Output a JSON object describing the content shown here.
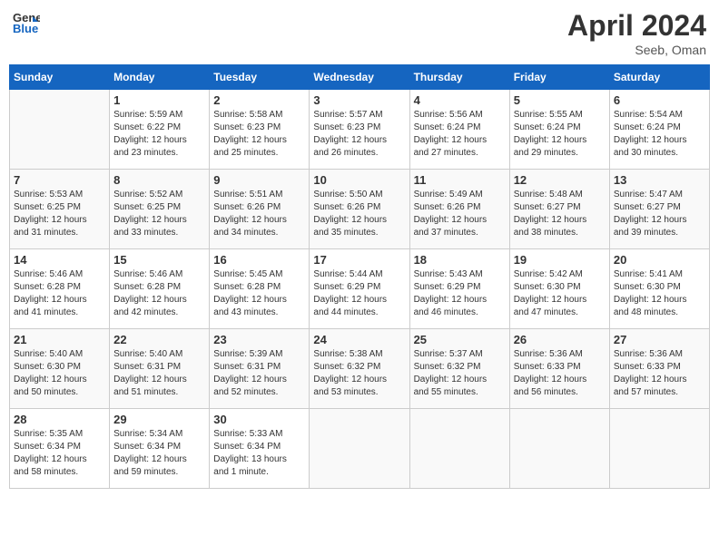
{
  "header": {
    "logo_line1": "General",
    "logo_line2": "Blue",
    "month": "April 2024",
    "location": "Seeb, Oman"
  },
  "weekdays": [
    "Sunday",
    "Monday",
    "Tuesday",
    "Wednesday",
    "Thursday",
    "Friday",
    "Saturday"
  ],
  "weeks": [
    [
      {
        "day": "",
        "info": ""
      },
      {
        "day": "1",
        "info": "Sunrise: 5:59 AM\nSunset: 6:22 PM\nDaylight: 12 hours\nand 23 minutes."
      },
      {
        "day": "2",
        "info": "Sunrise: 5:58 AM\nSunset: 6:23 PM\nDaylight: 12 hours\nand 25 minutes."
      },
      {
        "day": "3",
        "info": "Sunrise: 5:57 AM\nSunset: 6:23 PM\nDaylight: 12 hours\nand 26 minutes."
      },
      {
        "day": "4",
        "info": "Sunrise: 5:56 AM\nSunset: 6:24 PM\nDaylight: 12 hours\nand 27 minutes."
      },
      {
        "day": "5",
        "info": "Sunrise: 5:55 AM\nSunset: 6:24 PM\nDaylight: 12 hours\nand 29 minutes."
      },
      {
        "day": "6",
        "info": "Sunrise: 5:54 AM\nSunset: 6:24 PM\nDaylight: 12 hours\nand 30 minutes."
      }
    ],
    [
      {
        "day": "7",
        "info": "Sunrise: 5:53 AM\nSunset: 6:25 PM\nDaylight: 12 hours\nand 31 minutes."
      },
      {
        "day": "8",
        "info": "Sunrise: 5:52 AM\nSunset: 6:25 PM\nDaylight: 12 hours\nand 33 minutes."
      },
      {
        "day": "9",
        "info": "Sunrise: 5:51 AM\nSunset: 6:26 PM\nDaylight: 12 hours\nand 34 minutes."
      },
      {
        "day": "10",
        "info": "Sunrise: 5:50 AM\nSunset: 6:26 PM\nDaylight: 12 hours\nand 35 minutes."
      },
      {
        "day": "11",
        "info": "Sunrise: 5:49 AM\nSunset: 6:26 PM\nDaylight: 12 hours\nand 37 minutes."
      },
      {
        "day": "12",
        "info": "Sunrise: 5:48 AM\nSunset: 6:27 PM\nDaylight: 12 hours\nand 38 minutes."
      },
      {
        "day": "13",
        "info": "Sunrise: 5:47 AM\nSunset: 6:27 PM\nDaylight: 12 hours\nand 39 minutes."
      }
    ],
    [
      {
        "day": "14",
        "info": "Sunrise: 5:46 AM\nSunset: 6:28 PM\nDaylight: 12 hours\nand 41 minutes."
      },
      {
        "day": "15",
        "info": "Sunrise: 5:46 AM\nSunset: 6:28 PM\nDaylight: 12 hours\nand 42 minutes."
      },
      {
        "day": "16",
        "info": "Sunrise: 5:45 AM\nSunset: 6:28 PM\nDaylight: 12 hours\nand 43 minutes."
      },
      {
        "day": "17",
        "info": "Sunrise: 5:44 AM\nSunset: 6:29 PM\nDaylight: 12 hours\nand 44 minutes."
      },
      {
        "day": "18",
        "info": "Sunrise: 5:43 AM\nSunset: 6:29 PM\nDaylight: 12 hours\nand 46 minutes."
      },
      {
        "day": "19",
        "info": "Sunrise: 5:42 AM\nSunset: 6:30 PM\nDaylight: 12 hours\nand 47 minutes."
      },
      {
        "day": "20",
        "info": "Sunrise: 5:41 AM\nSunset: 6:30 PM\nDaylight: 12 hours\nand 48 minutes."
      }
    ],
    [
      {
        "day": "21",
        "info": "Sunrise: 5:40 AM\nSunset: 6:30 PM\nDaylight: 12 hours\nand 50 minutes."
      },
      {
        "day": "22",
        "info": "Sunrise: 5:40 AM\nSunset: 6:31 PM\nDaylight: 12 hours\nand 51 minutes."
      },
      {
        "day": "23",
        "info": "Sunrise: 5:39 AM\nSunset: 6:31 PM\nDaylight: 12 hours\nand 52 minutes."
      },
      {
        "day": "24",
        "info": "Sunrise: 5:38 AM\nSunset: 6:32 PM\nDaylight: 12 hours\nand 53 minutes."
      },
      {
        "day": "25",
        "info": "Sunrise: 5:37 AM\nSunset: 6:32 PM\nDaylight: 12 hours\nand 55 minutes."
      },
      {
        "day": "26",
        "info": "Sunrise: 5:36 AM\nSunset: 6:33 PM\nDaylight: 12 hours\nand 56 minutes."
      },
      {
        "day": "27",
        "info": "Sunrise: 5:36 AM\nSunset: 6:33 PM\nDaylight: 12 hours\nand 57 minutes."
      }
    ],
    [
      {
        "day": "28",
        "info": "Sunrise: 5:35 AM\nSunset: 6:34 PM\nDaylight: 12 hours\nand 58 minutes."
      },
      {
        "day": "29",
        "info": "Sunrise: 5:34 AM\nSunset: 6:34 PM\nDaylight: 12 hours\nand 59 minutes."
      },
      {
        "day": "30",
        "info": "Sunrise: 5:33 AM\nSunset: 6:34 PM\nDaylight: 13 hours\nand 1 minute."
      },
      {
        "day": "",
        "info": ""
      },
      {
        "day": "",
        "info": ""
      },
      {
        "day": "",
        "info": ""
      },
      {
        "day": "",
        "info": ""
      }
    ]
  ]
}
